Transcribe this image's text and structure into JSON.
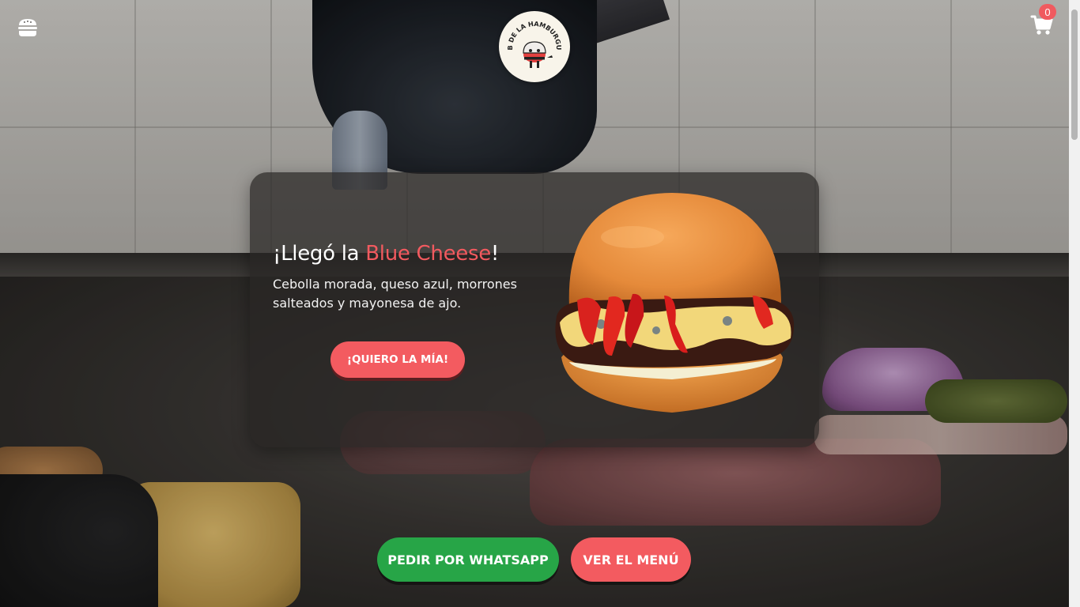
{
  "header": {
    "menu_icon": "burger-menu-icon",
    "logo_text": "CLUB DE LA HAMBURGUESA",
    "cart_icon": "cart-icon",
    "cart_count": "0"
  },
  "promo": {
    "title_prefix": "¡Llegó la ",
    "title_accent": "Blue Cheese",
    "title_suffix": "!",
    "description": "Cebolla morada, queso azul, morrones salteados y mayonesa de ajo.",
    "cta_label": "¡QUIERO LA MÍA!"
  },
  "actions": {
    "whatsapp_label": "PEDIR POR WHATSAPP",
    "menu_label": "VER EL MENÚ"
  },
  "colors": {
    "accent": "#f35b60",
    "whatsapp": "#27a547"
  }
}
